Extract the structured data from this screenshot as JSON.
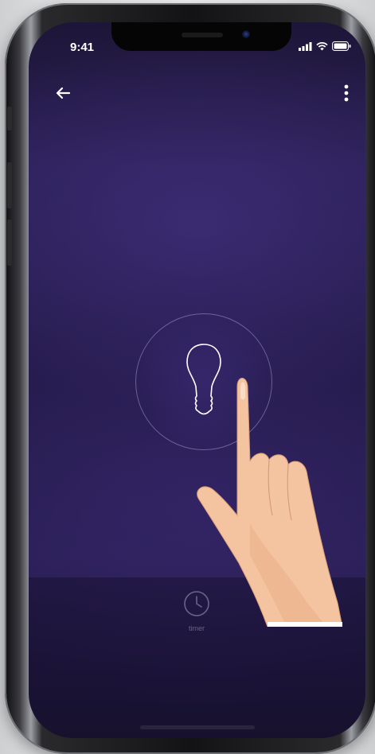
{
  "status_bar": {
    "time": "9:41",
    "icons": [
      "signal-icon",
      "wifi-icon",
      "battery-icon"
    ]
  },
  "nav": {
    "back_icon": "arrow-left-icon",
    "menu_icon": "more-vertical-icon"
  },
  "power_control": {
    "icon": "lightbulb-icon"
  },
  "footer": {
    "timer_icon": "clock-icon",
    "timer_label": "timer"
  },
  "colors": {
    "screen_background": "#251b4c",
    "ring_stroke": "#a096d2",
    "icon_color": "#ffffff",
    "timer_color": "#6b6488",
    "skin": "#f4c3a0"
  }
}
